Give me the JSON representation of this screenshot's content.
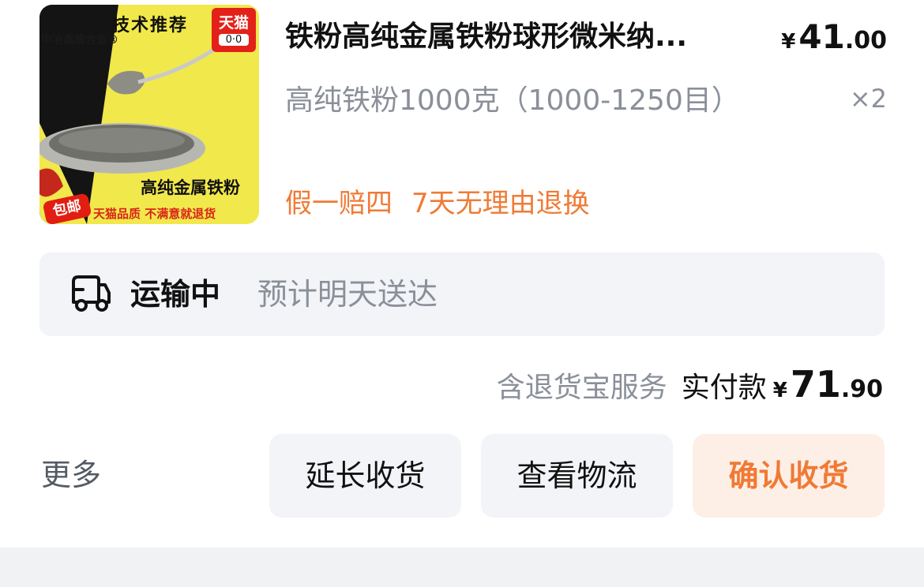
{
  "product": {
    "thumbnail": {
      "brand_text": "中冶鑫盾合金®",
      "tech_text": "技术推荐",
      "tmall_badge": "天猫",
      "tmall_face": "0·0",
      "headline": "高纯金属铁粉",
      "pack_tag": "包邮",
      "bottom_line": "天猫品质 不满意就退货",
      "bg_color": "#f1e84c"
    },
    "title": "铁粉高纯金属铁粉球形微米纳...",
    "price": {
      "currency": "¥",
      "int": "41",
      "dec": ".00"
    },
    "sku": "高纯铁粉1000克（1000-1250目）",
    "quantity": "×2",
    "promises": [
      "假一赔四",
      "7天无理由退换"
    ]
  },
  "logistics": {
    "icon": "truck-icon",
    "status": "运输中",
    "eta": "预计明天送达"
  },
  "payment": {
    "service": "含退货宝服务",
    "paid_label": "实付款",
    "currency": "¥",
    "int": "71",
    "dec": ".90"
  },
  "actions": {
    "more": "更多",
    "extend": "延长收货",
    "track": "查看物流",
    "confirm": "确认收货"
  },
  "colors": {
    "accent": "#f07a35",
    "accent_bg": "#fdefe6",
    "muted_text": "#8a8f99",
    "panel_bg": "#f2f4f7"
  }
}
